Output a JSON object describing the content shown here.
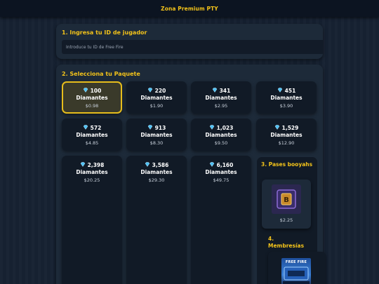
{
  "header": {
    "title": "Zona Premium PTY"
  },
  "player": {
    "title": "1. Ingresa tu ID de jugador",
    "placeholder": "Introduce tu ID de Free Fire"
  },
  "packages": {
    "title": "2. Selecciona tu Paquete",
    "unit": "Diamantes",
    "items": [
      {
        "amount": "100",
        "price": "$0.98",
        "selected": true
      },
      {
        "amount": "220",
        "price": "$1.90"
      },
      {
        "amount": "341",
        "price": "$2.95"
      },
      {
        "amount": "451",
        "price": "$3.90"
      },
      {
        "amount": "572",
        "price": "$4.85"
      },
      {
        "amount": "913",
        "price": "$8.30"
      },
      {
        "amount": "1,023",
        "price": "$9.50"
      },
      {
        "amount": "1,529",
        "price": "$12.90"
      },
      {
        "amount": "2,398",
        "price": "$20.25"
      },
      {
        "amount": "3,586",
        "price": "$29.30"
      },
      {
        "amount": "6,160",
        "price": "$49.75"
      }
    ]
  },
  "booyah": {
    "title": "3. Pases booyahs",
    "items": [
      {
        "price": "$2.25",
        "icon": "booyah-pass-icon"
      }
    ]
  },
  "membership": {
    "title": "4. Membresías",
    "items": [
      {
        "brand": "FREE FIRE",
        "icon": "free-fire-membership-icon"
      }
    ]
  },
  "colors": {
    "accent": "#f2c21a",
    "selected_border": "#e6bd1c",
    "card_bg": "#111a26",
    "panel_bg": "#1d2a39",
    "gem": "#4fc3f7"
  }
}
